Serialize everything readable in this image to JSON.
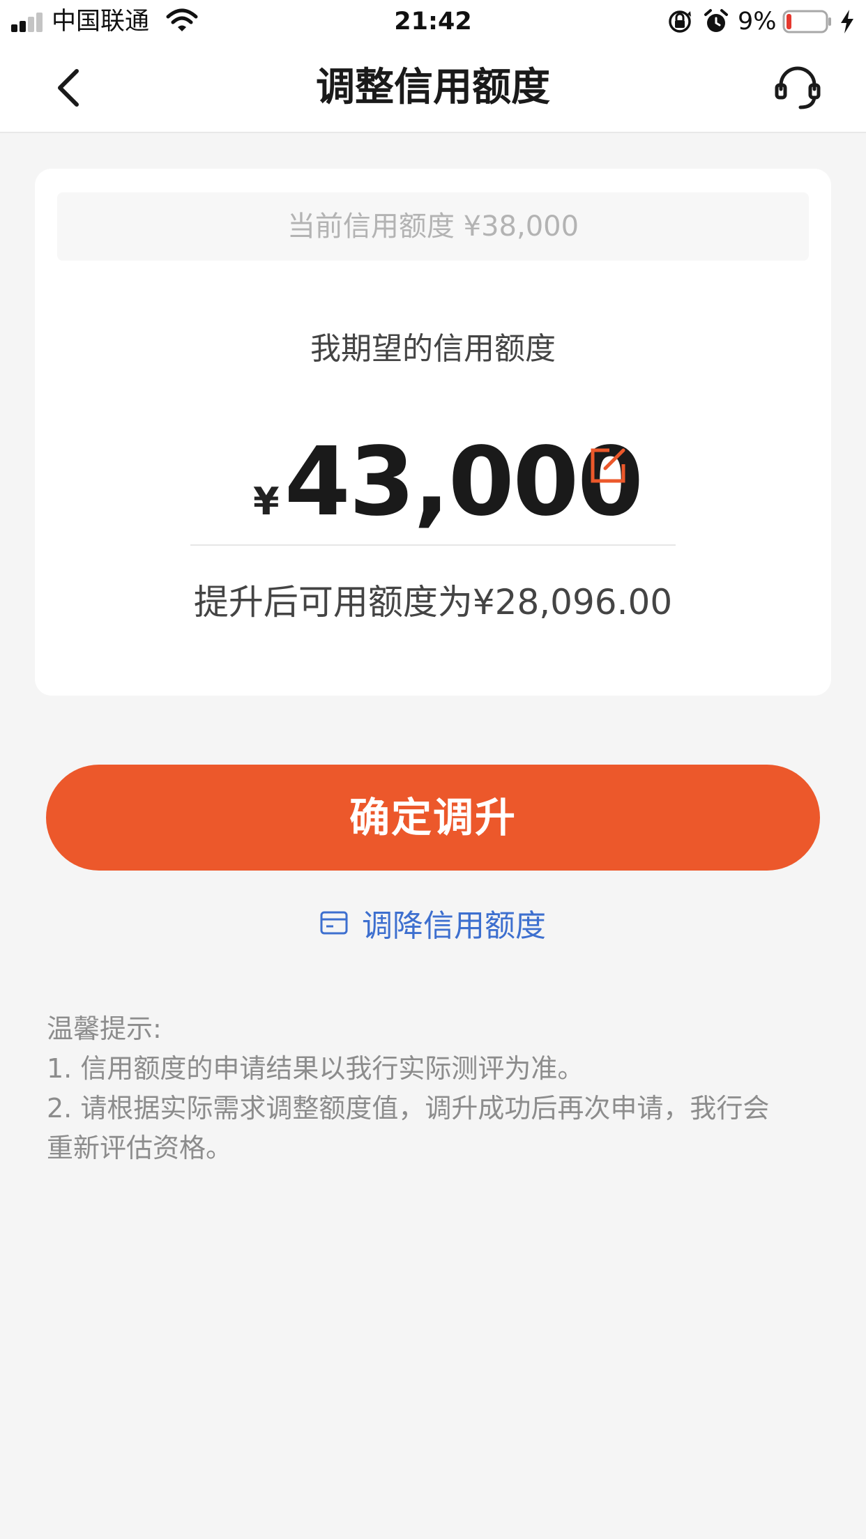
{
  "status_bar": {
    "carrier": "中国联通",
    "time": "21:42",
    "battery_percent": "9%",
    "battery_level": 0.09,
    "signal_bars": 2,
    "icons": [
      "signal-icon",
      "wifi-icon",
      "orientation-lock-icon",
      "alarm-icon",
      "battery-icon",
      "charging-icon"
    ]
  },
  "nav": {
    "title": "调整信用额度",
    "back_icon": "chevron-left-icon",
    "service_icon": "headset-icon"
  },
  "card": {
    "current_limit": "当前信用额度 ¥38,000",
    "expected_label": "我期望的信用额度",
    "currency_symbol": "¥",
    "amount": "43,000",
    "edit_icon": "edit-icon",
    "available_text": "提升后可用额度为¥28,096.00"
  },
  "actions": {
    "confirm_label": "确定调升",
    "decrease_label": "调降信用额度",
    "decrease_icon": "card-icon"
  },
  "tips": {
    "title": "温馨提示:",
    "line1": "1. 信用额度的申请结果以我行实际测评为准。",
    "line2a": "2. 请根据实际需求调整额度值，调升成功后再次申请，我行会",
    "line2b": "重新评估资格。"
  },
  "colors": {
    "accent": "#ec582b",
    "link": "#3d6fcf",
    "background": "#f5f5f5",
    "battery_low": "#e5392f"
  }
}
